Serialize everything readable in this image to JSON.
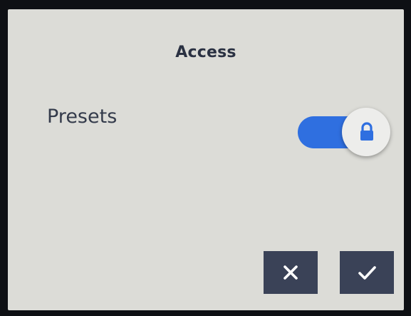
{
  "screen": {
    "title": "Access"
  },
  "settings": [
    {
      "label": "Presets",
      "toggle_state": "on",
      "locked": true,
      "icon": "lock-icon"
    }
  ],
  "actions": {
    "cancel_icon": "close-icon",
    "confirm_icon": "checkmark-icon"
  },
  "colors": {
    "screen_bg": "#dcdcd7",
    "toggle_on": "#2f6fe0",
    "button_bg": "#3a4257",
    "text": "#343b4b"
  }
}
